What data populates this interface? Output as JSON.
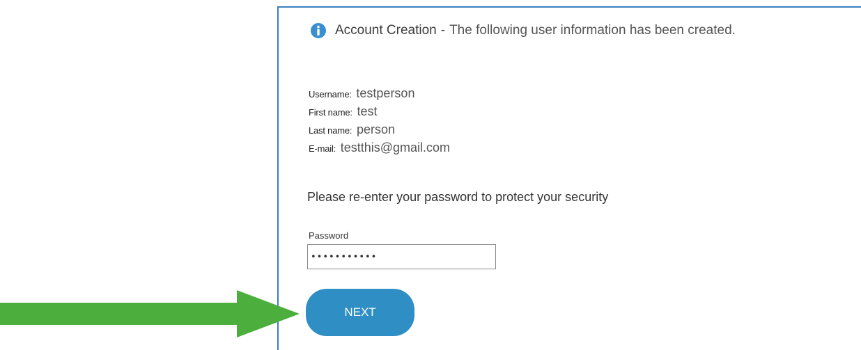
{
  "header": {
    "icon": "info-icon",
    "title": "Account Creation",
    "separator": "-",
    "description": "The following user information has been created."
  },
  "details": [
    {
      "label": "Username:",
      "value": "testperson"
    },
    {
      "label": "First name:",
      "value": "test"
    },
    {
      "label": "Last name:",
      "value": "person"
    },
    {
      "label": "E-mail:",
      "value": "testthis@gmail.com"
    }
  ],
  "prompt": "Please re-enter your password to protect your security",
  "password": {
    "label": "Password",
    "value": "•••••••••••"
  },
  "next_button": {
    "label": "NEXT"
  },
  "colors": {
    "accent": "#2f8ec4",
    "border": "#3a7fbf",
    "arrow": "#4caf3d"
  }
}
